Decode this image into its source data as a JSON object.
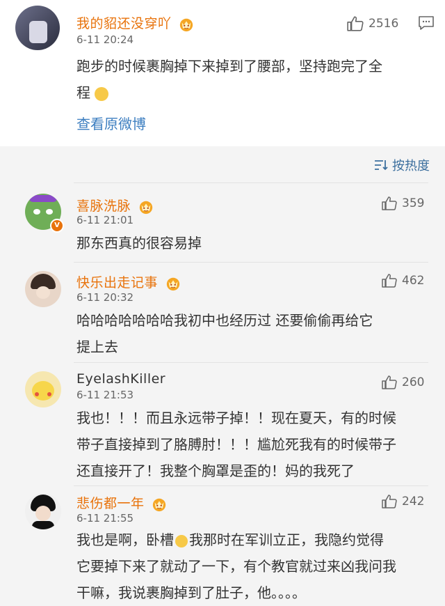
{
  "main_post": {
    "username": "我的貂还没穿吖",
    "time": "6-11 20:24",
    "likes": "2516",
    "text_line1": "跑步的时候裹胸掉下来掉到了腰部，坚持跑完了全",
    "text_line2": "程",
    "view_original": "查看原微博"
  },
  "sort": {
    "label": "按热度"
  },
  "comments": [
    {
      "username": "喜脉洗脉",
      "time": "6-11 21:01",
      "likes": "359",
      "lines": [
        "那东西真的很容易掉"
      ]
    },
    {
      "username": "快乐出走记事",
      "time": "6-11 20:32",
      "likes": "462",
      "lines": [
        "哈哈哈哈哈哈哈我初中也经历过 还要偷偷再给它",
        "提上去"
      ]
    },
    {
      "username": "EyelashKiller",
      "time": "6-11 21:53",
      "likes": "260",
      "lines": [
        "我也！！！而且永远带子掉！！现在夏天，有的时候",
        "带子直接掉到了胳膊肘！！！尴尬死我有的时候带子",
        "还直接开了！我整个胸罩是歪的！妈的我死了"
      ]
    },
    {
      "username": "悲伤都一年",
      "time": "6-11 21:55",
      "likes": "242",
      "lines": [
        "我也是啊，卧槽",
        "我那时在军训立正，我隐约觉得",
        "它要掉下来了就动了一下，有个教官就过来凶我问我",
        "干嘛，我说裹胸掉到了肚子，他。。。。"
      ]
    }
  ],
  "colors": {
    "vip_name": "#e8730c",
    "link": "#3c7ec0",
    "background": "#f4f4f4"
  }
}
